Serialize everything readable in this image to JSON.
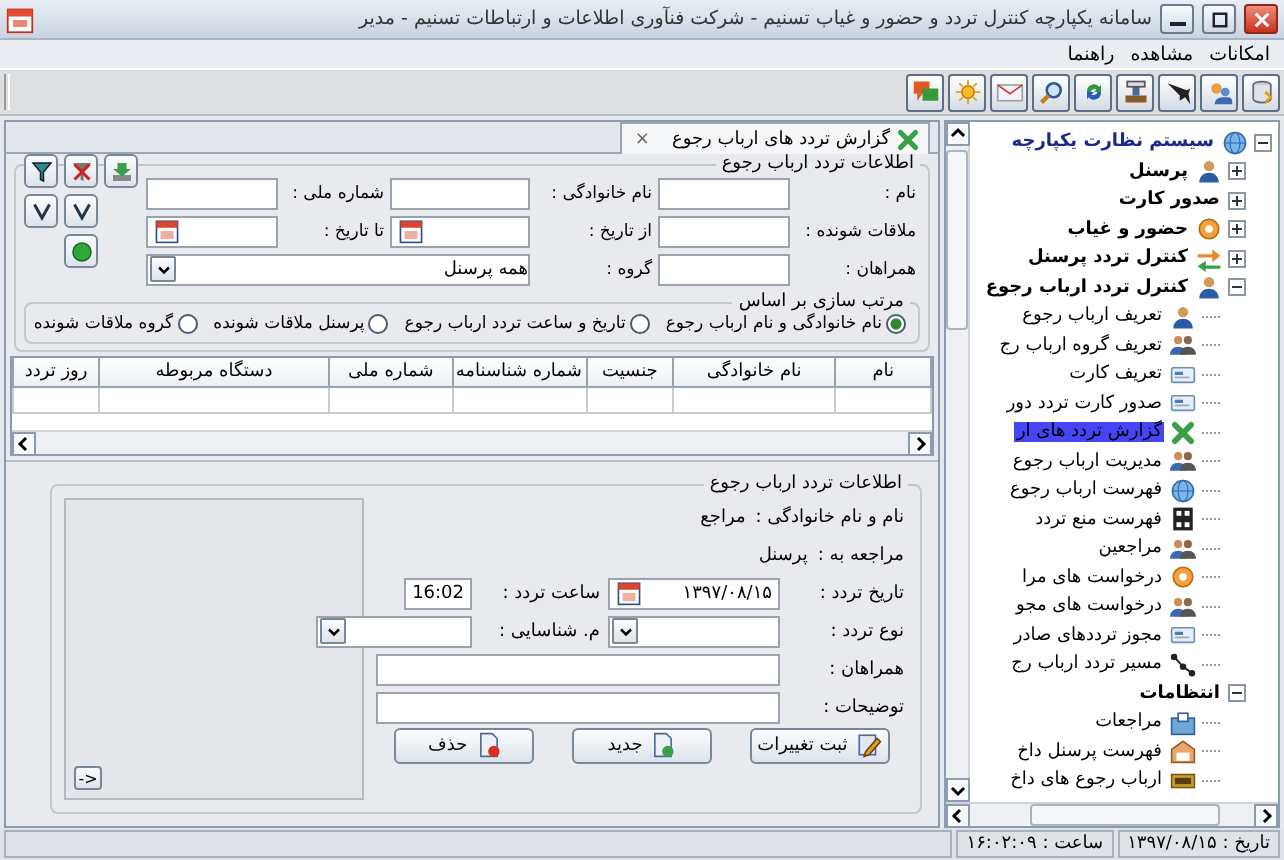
{
  "window": {
    "title": "سامانه یکپارچه کنترل تردد و حضور و غیاب تسنیم - شرکت فنآوری اطلاعات و ارتباطات تسنیم - مدیر"
  },
  "menu": [
    "امکانات",
    "مشاهده",
    "راهنما"
  ],
  "tab": {
    "title": "گزارش تردد های ارباب رجوع",
    "close": "×"
  },
  "filter": {
    "legend": "اطلاعات تردد ارباب رجوع",
    "fields": [
      {
        "label": "نام :",
        "kind": "text"
      },
      {
        "label": "نام خانوادگی :",
        "kind": "text"
      },
      {
        "label": "شماره ملی :",
        "kind": "text"
      },
      {
        "label": "ملاقات شونده :",
        "kind": "text"
      },
      {
        "label": "از تاریخ :",
        "kind": "date"
      },
      {
        "label": "تا تاریخ :",
        "kind": "date"
      },
      {
        "label": "همراهان :",
        "kind": "text"
      }
    ],
    "group": {
      "label": "گروه :",
      "value": "همه پرسنل"
    },
    "sort": {
      "legend": "مرتب سازی بر اساس",
      "options": [
        {
          "label": "نام خانوادگی و نام ارباب رجوع",
          "selected": true
        },
        {
          "label": "تاریخ و ساعت تردد ارباب رجوع",
          "selected": false
        },
        {
          "label": "پرسنل ملاقات شونده",
          "selected": false
        },
        {
          "label": "گروه ملاقات شونده",
          "selected": false
        }
      ]
    }
  },
  "table": {
    "columns": [
      "نام",
      "نام خانوادگی",
      "جنسیت",
      "شماره شناسنامه",
      "شماره ملی",
      "دستگاه مربوطه",
      "روز تردد"
    ]
  },
  "detail": {
    "legend": "اطلاعات تردد ارباب رجوع",
    "info": [
      {
        "label": "نام و نام خانوادگی :",
        "value": "مراجع"
      },
      {
        "label": "مراجعه به :",
        "value": "پرسنل"
      }
    ],
    "date": {
      "label": "تاریخ  تردد :",
      "value": "۱۳۹۷/۰۸/۱۵"
    },
    "time": {
      "label": "ساعت تردد :",
      "value": "16:02"
    },
    "entry_type": {
      "label": "نوع تردد :"
    },
    "id_type": {
      "label": "م. شناسایی :"
    },
    "companions": {
      "label": "همراهان :"
    },
    "notes": {
      "label": "توضیحات :"
    },
    "buttons": [
      "ثبت تغییرات",
      "جدید",
      "حذف"
    ],
    "photo_toggle": "->"
  },
  "tree": {
    "items": [
      {
        "label": "سیستم نظارت یکپارچه",
        "expanded": true,
        "selected": false,
        "children": [
          {
            "label": "پرسنل",
            "expanded": false,
            "selected": false
          },
          {
            "label": "صدور کارت",
            "expanded": false,
            "selected": false
          },
          {
            "label": "حضور و غیاب",
            "expanded": false,
            "selected": false
          },
          {
            "label": "کنترل تردد پرسنل",
            "expanded": false,
            "selected": false
          },
          {
            "label": "کنترل تردد ارباب رجوع",
            "expanded": true,
            "selected": false,
            "children": [
              {
                "label": "تعریف ارباب رجوع",
                "selected": false
              },
              {
                "label": "تعریف گروه ارباب رج",
                "selected": false
              },
              {
                "label": "تعریف کارت",
                "selected": false
              },
              {
                "label": "صدور کارت تردد دور",
                "selected": false
              },
              {
                "label": "گزارش تردد های ار",
                "selected": true
              },
              {
                "label": "مدیریت ارباب رجوع",
                "selected": false
              },
              {
                "label": "فهرست ارباب رجوع",
                "selected": false
              },
              {
                "label": "فهرست منع تردد",
                "selected": false
              },
              {
                "label": "مراجعین",
                "selected": false
              },
              {
                "label": "درخواست های مرا",
                "selected": false
              },
              {
                "label": "درخواست های مجو",
                "selected": false
              },
              {
                "label": "مجوز ترددهای صادر",
                "selected": false
              },
              {
                "label": "مسیر تردد ارباب رج",
                "selected": false
              }
            ]
          },
          {
            "label": "انتظامات",
            "expanded": true,
            "selected": false,
            "children": [
              {
                "label": "مراجعات",
                "selected": false
              },
              {
                "label": "فهرست پرسنل داخ",
                "selected": false
              },
              {
                "label": "ارباب رجوع های داخ",
                "selected": false
              }
            ]
          }
        ]
      }
    ]
  },
  "status_bar": {
    "date": "تاریخ : ۱۳۹۷/۰۸/۱۵",
    "time": "ساعت : ۱۶:۰۲:۰۹"
  }
}
